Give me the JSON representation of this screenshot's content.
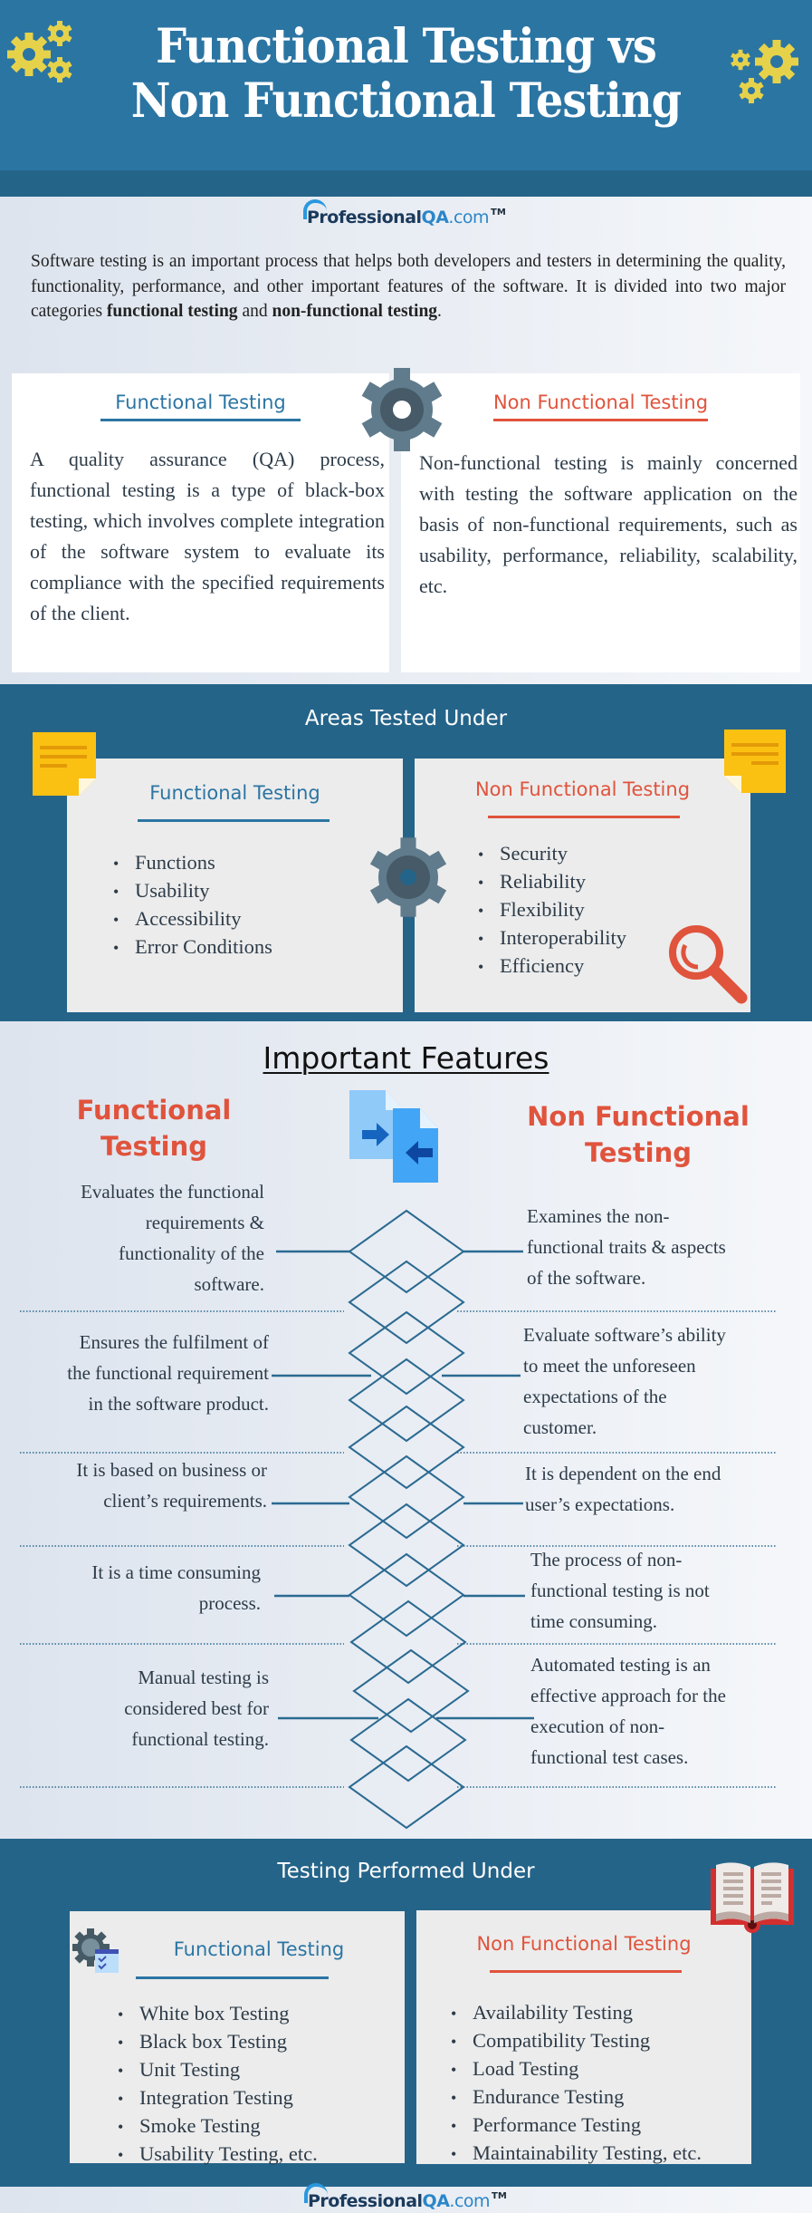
{
  "header": {
    "title_line1": "Functional Testing vs",
    "title_line2": "Non Functional Testing",
    "icon": "gears-icon"
  },
  "brand": {
    "name_part1": "Professional",
    "name_part2": "QA",
    "name_part3": ".com",
    "trademark": "TM"
  },
  "intro": {
    "text": "Software testing is an important process that helps both developers and testers in determining the quality, functionality, performance, and other important features of the software. It is divided into two major categories ",
    "bold1": "functional testing",
    "joiner": " and ",
    "bold2": "non-functional testing",
    "end": "."
  },
  "definitions": {
    "functional": {
      "title": "Functional Testing",
      "text": "A quality assurance (QA) process, functional testing is a type of black-box testing, which involves complete integration of the software system to evaluate its compliance with the specified requirements of the client."
    },
    "non_functional": {
      "title": "Non Functional Testing",
      "text": "Non-functional testing is mainly concerned with testing the software application on the basis of non-functional requirements, such as usability, performance, reliability, scalability, etc."
    }
  },
  "areas": {
    "title": "Areas Tested Under",
    "functional": {
      "title": "Functional Testing",
      "items": [
        "Functions",
        "Usability",
        "Accessibility",
        "Error Conditions"
      ]
    },
    "non_functional": {
      "title": "Non Functional Testing",
      "items": [
        "Security",
        "Reliability",
        "Flexibility",
        "Interoperability",
        "Efficiency"
      ]
    }
  },
  "features": {
    "title": "Important Features",
    "functional_heading_1": "Functional",
    "functional_heading_2": "Testing",
    "non_functional_heading_1": "Non Functional",
    "non_functional_heading_2": "Testing",
    "rows": [
      {
        "functional": [
          "Evaluates the functional",
          "requirements &",
          "functionality of the",
          "software."
        ],
        "non_functional": [
          "Examines the non-",
          "functional traits & aspects",
          "of the software."
        ]
      },
      {
        "functional": [
          "Ensures the fulfilment of",
          "the functional requirement",
          "in the software product."
        ],
        "non_functional": [
          "Evaluate software’s ability",
          "to meet the unforeseen",
          "expectations of the",
          "customer."
        ]
      },
      {
        "functional": [
          "It is based on business or",
          "client’s requirements."
        ],
        "non_functional": [
          "It is dependent on the end",
          "user’s expectations."
        ]
      },
      {
        "functional": [
          "It is a time consuming",
          "process."
        ],
        "non_functional": [
          "The process of non-",
          "functional testing is not",
          "time consuming."
        ]
      },
      {
        "functional": [
          "Manual testing is",
          "considered best for",
          "functional testing."
        ],
        "non_functional": [
          "Automated testing is an",
          "effective approach for the",
          "execution of non-",
          "functional test cases."
        ]
      }
    ]
  },
  "testing": {
    "title": "Testing Performed Under",
    "functional": {
      "title": "Functional Testing",
      "items": [
        "White box Testing",
        "Black box Testing",
        "Unit Testing",
        "Integration Testing",
        "Smoke Testing",
        "Usability Testing, etc."
      ]
    },
    "non_functional": {
      "title": "Non Functional Testing",
      "items": [
        "Availability Testing",
        "Compatibility Testing",
        "Load Testing",
        "Endurance Testing",
        "Performance Testing",
        "Maintainability Testing, etc."
      ]
    }
  },
  "colors": {
    "header_blue": "#2b75a3",
    "dark_blue": "#256489",
    "accent_red": "#e0533c",
    "gear_yellow": "#e6d24a",
    "note_yellow": "#fbc112"
  }
}
